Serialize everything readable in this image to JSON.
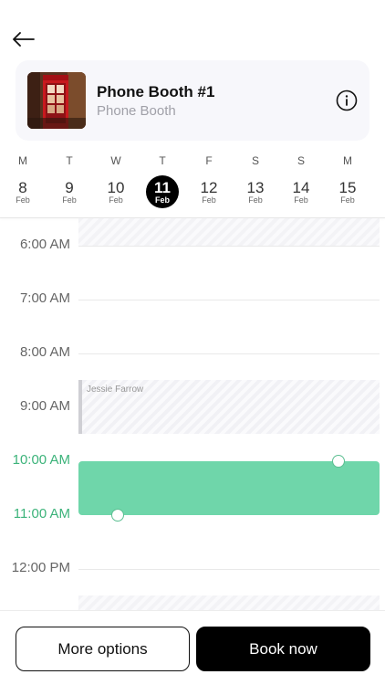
{
  "header": {
    "back_icon": "arrow-left-icon"
  },
  "room": {
    "title": "Phone Booth #1",
    "subtitle": "Phone Booth",
    "info_icon": "info-circle-icon"
  },
  "days": [
    {
      "dow": "M",
      "num": "8",
      "mon": "Feb",
      "selected": false
    },
    {
      "dow": "T",
      "num": "9",
      "mon": "Feb",
      "selected": false
    },
    {
      "dow": "W",
      "num": "10",
      "mon": "Feb",
      "selected": false
    },
    {
      "dow": "T",
      "num": "11",
      "mon": "Feb",
      "selected": true
    },
    {
      "dow": "F",
      "num": "12",
      "mon": "Feb",
      "selected": false
    },
    {
      "dow": "S",
      "num": "13",
      "mon": "Feb",
      "selected": false
    },
    {
      "dow": "S",
      "num": "14",
      "mon": "Feb",
      "selected": false
    },
    {
      "dow": "M",
      "num": "15",
      "mon": "Feb",
      "selected": false
    }
  ],
  "timeline": {
    "hours": [
      "6:00 AM",
      "7:00 AM",
      "8:00 AM",
      "9:00 AM",
      "10:00 AM",
      "11:00 AM",
      "12:00 PM"
    ],
    "highlighted_hours": [
      "10:00 AM",
      "11:00 AM"
    ],
    "booking": {
      "name": "Jessie Farrow"
    }
  },
  "colors": {
    "selection": "#6fd6aa",
    "accent_green": "#3cb37a",
    "selected_day": "#000000"
  },
  "footer": {
    "more_options_label": "More options",
    "book_now_label": "Book now"
  }
}
